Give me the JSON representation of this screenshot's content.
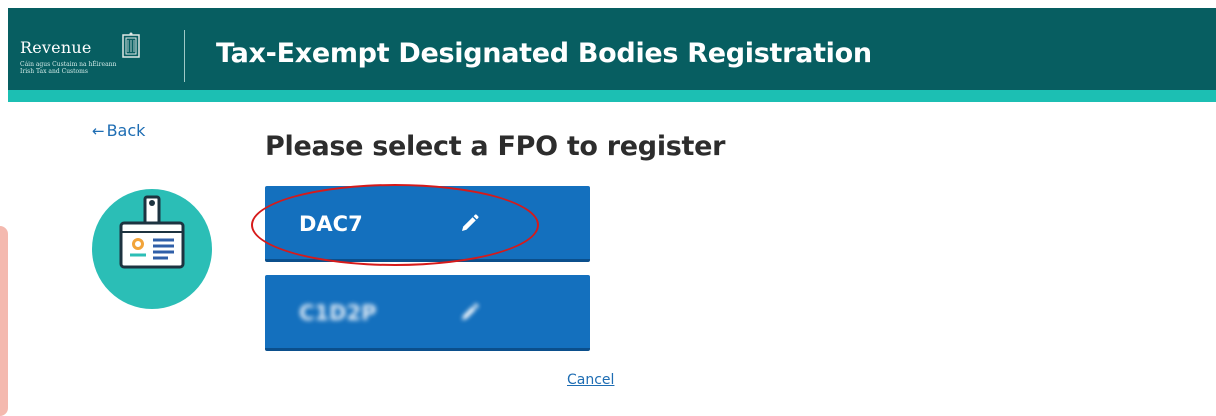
{
  "header": {
    "logo_text": "Revenue",
    "logo_subtitle_line1": "Cáin agus Custaim na hÉireann",
    "logo_subtitle_line2": "Irish Tax and Customs",
    "logo_icon": "harp-icon",
    "title": "Tax-Exempt Designated Bodies Registration",
    "bar_color": "#075e61",
    "stripe_color": "#1cbfb3"
  },
  "nav": {
    "back_label": "Back",
    "back_icon": "arrow-left-icon"
  },
  "badge": {
    "icon": "id-badge-icon",
    "circle_color": "#2bbeb6"
  },
  "main": {
    "title": "Please select a FPO to register",
    "options": [
      {
        "label": "DAC7",
        "icon": "pencil-icon",
        "highlighted": true
      },
      {
        "label": "C1D2P",
        "icon": "pencil-icon",
        "blurred": true
      }
    ],
    "button_color": "#1470be",
    "cancel_label": "Cancel"
  },
  "annotation": {
    "color": "#d61a1a"
  }
}
